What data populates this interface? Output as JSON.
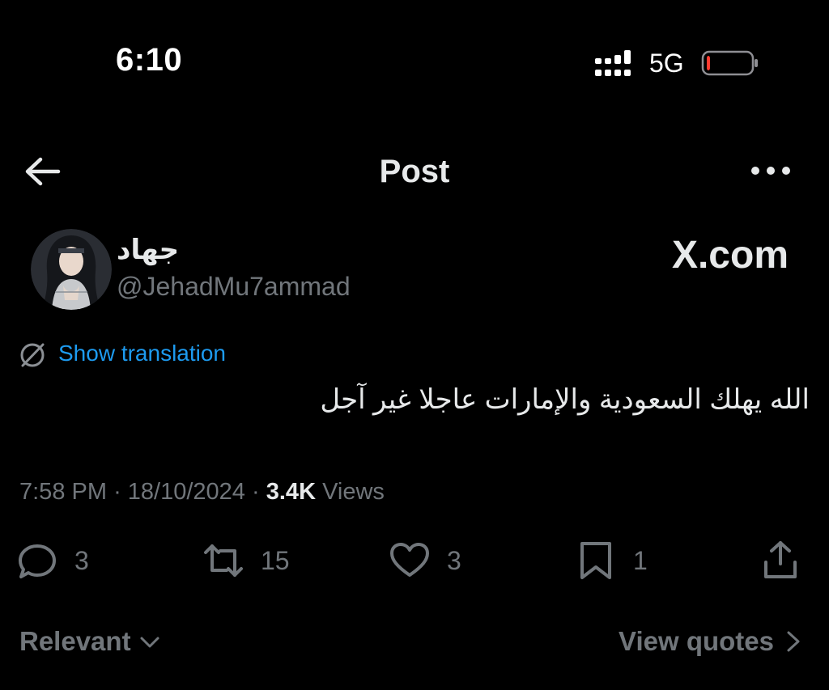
{
  "status_bar": {
    "time": "6:10",
    "network": "5G",
    "battery_level": 0.08,
    "battery_color": "#ff3b30"
  },
  "header": {
    "title": "Post",
    "back_icon": "arrow-left-icon",
    "more_icon": "ellipsis-icon"
  },
  "author": {
    "display_name": "جهاد",
    "handle": "@JehadMu7ammad"
  },
  "watermark": "X.com",
  "translation": {
    "label": "Show translation",
    "icon": "translate-slash-icon"
  },
  "post": {
    "text": "الله يهلك السعودية والإمارات عاجلا غير آجل"
  },
  "meta": {
    "time": "7:58 PM",
    "separator": "·",
    "date": "18/10/2024",
    "views_count": "3.4K",
    "views_label": "Views"
  },
  "actions": {
    "replies": "3",
    "reposts": "15",
    "likes": "3",
    "bookmarks": "1"
  },
  "footer": {
    "sort_label": "Relevant",
    "quotes_label": "View quotes"
  },
  "colors": {
    "background": "#000000",
    "text_primary": "#e7e9ea",
    "text_secondary": "#71767b",
    "link": "#1d9bf0"
  }
}
